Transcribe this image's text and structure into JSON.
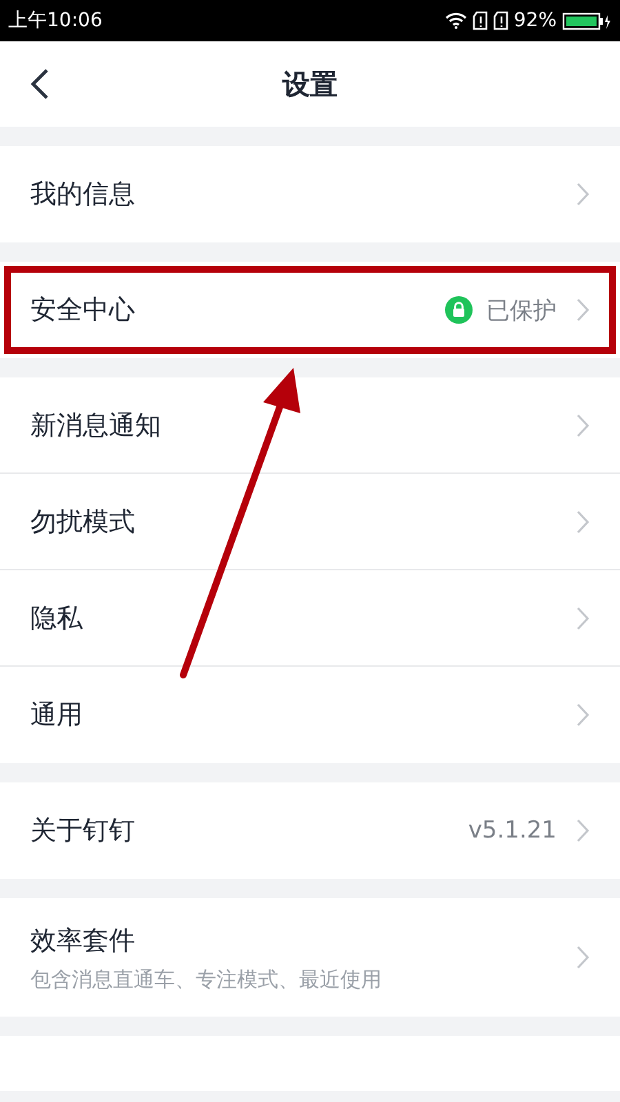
{
  "status_bar": {
    "time": "上午10:06",
    "battery": "92%"
  },
  "nav": {
    "title": "设置"
  },
  "groups": [
    {
      "items": [
        {
          "kind": "plain",
          "label": "我的信息",
          "highlighted": false
        }
      ]
    },
    {
      "items": [
        {
          "kind": "status",
          "label": "安全中心",
          "value": "已保护",
          "highlighted": true
        }
      ]
    },
    {
      "items": [
        {
          "kind": "plain",
          "label": "新消息通知",
          "highlighted": false
        },
        {
          "kind": "plain",
          "label": "勿扰模式",
          "highlighted": false
        },
        {
          "kind": "plain",
          "label": "隐私",
          "highlighted": false
        },
        {
          "kind": "plain",
          "label": "通用",
          "highlighted": false
        }
      ]
    },
    {
      "items": [
        {
          "kind": "value",
          "label": "关于钉钉",
          "value": "v5.1.21",
          "highlighted": false
        }
      ]
    },
    {
      "items": [
        {
          "kind": "subtitle",
          "label": "效率套件",
          "subtitle": "包含消息直通车、专注模式、最近使用",
          "highlighted": false
        }
      ]
    },
    {
      "items": [
        {
          "kind": "cut"
        }
      ]
    }
  ],
  "pointer_arrow": true
}
